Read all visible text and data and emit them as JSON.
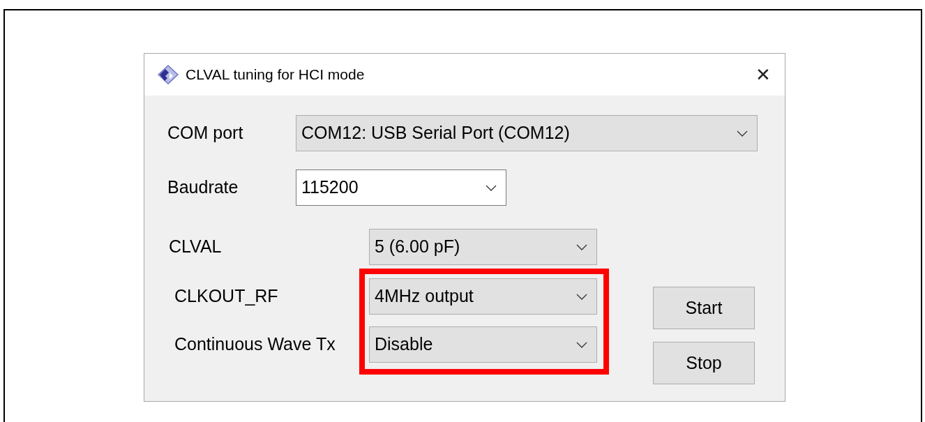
{
  "window": {
    "title": "CLVAL tuning for HCI mode",
    "close": "✕"
  },
  "port_settings": [
    {
      "label": "COM port",
      "value": "COM12: USB Serial Port (COM12)",
      "kind": "dropdown"
    },
    {
      "label": "Baudrate",
      "value": "115200",
      "kind": "editable"
    }
  ],
  "tuning_settings": [
    {
      "label": "CLVAL",
      "value": "5 (6.00 pF)",
      "kind": "dropdown",
      "highlighted": false
    },
    {
      "label": "CLKOUT_RF",
      "value": "4MHz output",
      "kind": "dropdown",
      "highlighted": true
    },
    {
      "label": "Continuous Wave Tx",
      "value": "Disable",
      "kind": "dropdown",
      "highlighted": true
    }
  ],
  "buttons": [
    "Start",
    "Stop"
  ]
}
